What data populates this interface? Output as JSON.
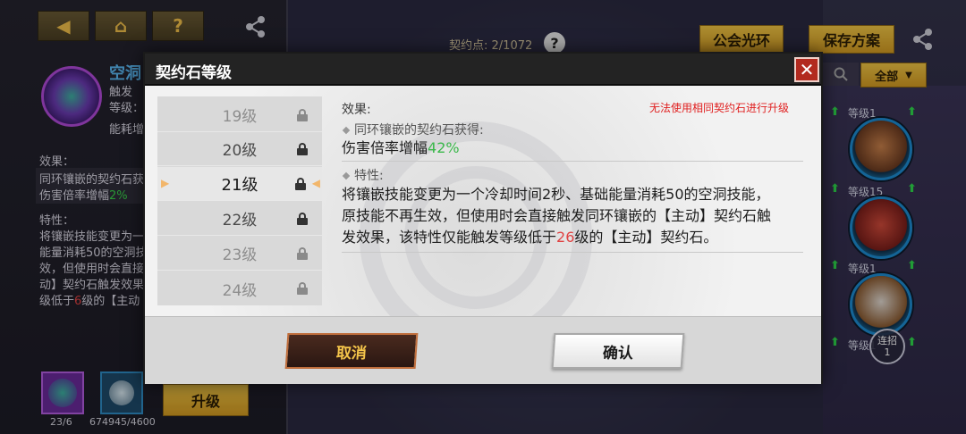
{
  "background": {
    "toolbar_icons": [
      "back-arrow-icon",
      "home-icon",
      "help-icon"
    ],
    "contract_points_label": "契约点",
    "contract_points_value": "2/1072",
    "help_glyph": "?",
    "guild_halo_label": "公会光环",
    "save_plan_label": "保存方案",
    "filter_label": "全部",
    "left": {
      "skill_name": "空洞",
      "trigger": "触发",
      "level_prefix": "等级：",
      "cost_prefix": "能耗增",
      "effect_label": "效果：",
      "effect_line1": "同环镶嵌的契约石获得",
      "effect_line2_prefix": "伤害倍率增幅",
      "effect_line2_value": "2%",
      "trait_label": "特性：",
      "trait_lines": [
        "将镶嵌技能变更为一",
        "能量消耗50的空洞技",
        "效，但使用时会直接",
        "动】契约石触发效果"
      ],
      "trait_last_prefix": "级低于",
      "trait_last_value": "6",
      "trait_last_suffix": "级的【主动",
      "item1_count": "23/6",
      "item2_count": "674945/4600",
      "upgrade_label": "升级"
    },
    "right_heroes": [
      {
        "level": "等级1"
      },
      {
        "level": "等级15"
      },
      {
        "level": "等级1"
      },
      {
        "level": "等级1"
      }
    ],
    "combo_label": "连招",
    "combo_value": "1"
  },
  "modal": {
    "title": "契约石等级",
    "close_glyph": "✕",
    "levels": [
      "19级",
      "20级",
      "21级",
      "22级",
      "23级",
      "24级"
    ],
    "selected_level": "21级",
    "effect_label": "效果:",
    "warning": "无法使用相同契约石进行升级",
    "bonus_label": "同环镶嵌的契约石获得:",
    "bonus_text_prefix": "伤害倍率增幅",
    "bonus_value": "42%",
    "trait_label": "特性:",
    "trait_line1": "将镶嵌技能变更为一个冷却时间2秒、基础能量消耗50的空洞技能，",
    "trait_line2": "原技能不再生效，但使用时会直接触发同环镶嵌的【主动】契约石触",
    "trait_line3_prefix": "发效果，该特性仅能触发等级低于",
    "trait_line3_value": "26",
    "trait_line3_suffix": "级的【主动】契约石。",
    "cancel_label": "取消",
    "confirm_label": "确认"
  }
}
